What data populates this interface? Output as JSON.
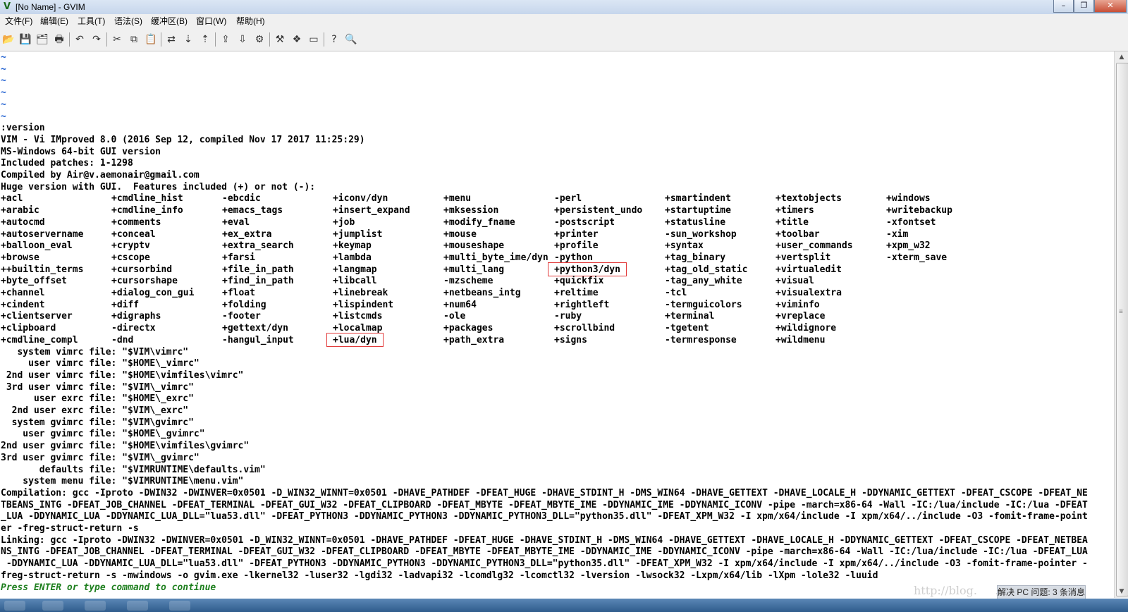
{
  "window": {
    "title": "[No Name] - GVIM"
  },
  "menubar": [
    "文件(F)",
    "编辑(E)",
    "工具(T)",
    "语法(S)",
    "缓冲区(B)",
    "窗口(W)",
    "帮助(H)"
  ],
  "toolbar": [
    {
      "name": "open-icon",
      "glyph": "📂"
    },
    {
      "name": "save-icon",
      "glyph": "💾"
    },
    {
      "name": "save-all-icon",
      "glyph": "🗂"
    },
    {
      "name": "print-icon",
      "glyph": "🖶"
    },
    {
      "sep": true
    },
    {
      "name": "undo-icon",
      "glyph": "↶"
    },
    {
      "name": "redo-icon",
      "glyph": "↷"
    },
    {
      "sep": true
    },
    {
      "name": "cut-icon",
      "glyph": "✂"
    },
    {
      "name": "copy-icon",
      "glyph": "⧉"
    },
    {
      "name": "paste-icon",
      "glyph": "📋"
    },
    {
      "sep": true
    },
    {
      "name": "replace-icon",
      "glyph": "⇄"
    },
    {
      "name": "find-next-icon",
      "glyph": "⇣"
    },
    {
      "name": "find-prev-icon",
      "glyph": "⇡"
    },
    {
      "sep": true
    },
    {
      "name": "load-session-icon",
      "glyph": "⇪"
    },
    {
      "name": "save-session-icon",
      "glyph": "⇩"
    },
    {
      "name": "run-script-icon",
      "glyph": "⚙"
    },
    {
      "sep": true
    },
    {
      "name": "make-icon",
      "glyph": "⚒"
    },
    {
      "name": "shell-icon",
      "glyph": "❖"
    },
    {
      "name": "tags-icon",
      "glyph": "▭"
    },
    {
      "sep": true
    },
    {
      "name": "help-icon",
      "glyph": "?"
    },
    {
      "name": "find-help-icon",
      "glyph": "🔍"
    }
  ],
  "editor": {
    "tilde_lines": [
      "~",
      "~",
      "~",
      "~",
      "~",
      "~"
    ],
    "header_lines": [
      ":version",
      "VIM - Vi IMproved 8.0 (2016 Sep 12, compiled Nov 17 2017 11:25:29)",
      "MS-Windows 64-bit GUI version",
      "Included patches: 1-1298",
      "Compiled by Air@v.aemonair@gmail.com",
      "Huge version with GUI.  Features included (+) or not (-):"
    ],
    "feature_columns": [
      [
        "+acl",
        "+arabic",
        "+autocmd",
        "+autoservername",
        "+balloon_eval",
        "+browse",
        "++builtin_terms",
        "+byte_offset",
        "+channel",
        "+cindent",
        "+clientserver",
        "+clipboard",
        "+cmdline_compl"
      ],
      [
        "+cmdline_hist",
        "+cmdline_info",
        "+comments",
        "+conceal",
        "+cryptv",
        "+cscope",
        "+cursorbind",
        "+cursorshape",
        "+dialog_con_gui",
        "+diff",
        "+digraphs",
        "-directx",
        "-dnd"
      ],
      [
        "-ebcdic",
        "+emacs_tags",
        "+eval",
        "+ex_extra",
        "+extra_search",
        "+farsi",
        "+file_in_path",
        "+find_in_path",
        "+float",
        "+folding",
        "-footer",
        "+gettext/dyn",
        "-hangul_input"
      ],
      [
        "+iconv/dyn",
        "+insert_expand",
        "+job",
        "+jumplist",
        "+keymap",
        "+lambda",
        "+langmap",
        "+libcall",
        "+linebreak",
        "+lispindent",
        "+listcmds",
        "+localmap",
        "+lua/dyn"
      ],
      [
        "+menu",
        "+mksession",
        "+modify_fname",
        "+mouse",
        "+mouseshape",
        "+multi_byte_ime/dyn",
        "+multi_lang",
        "-mzscheme",
        "+netbeans_intg",
        "+num64",
        "-ole",
        "+packages",
        "+path_extra"
      ],
      [
        "-perl",
        "+persistent_undo",
        "-postscript",
        "+printer",
        "+profile",
        "-python",
        "+python3/dyn",
        "+quickfix",
        "+reltime",
        "+rightleft",
        "-ruby",
        "+scrollbind",
        "+signs"
      ],
      [
        "+smartindent",
        "+startuptime",
        "+statusline",
        "-sun_workshop",
        "+syntax",
        "+tag_binary",
        "+tag_old_static",
        "-tag_any_white",
        "-tcl",
        "-termguicolors",
        "+terminal",
        "-tgetent",
        "-termresponse"
      ],
      [
        "+textobjects",
        "+timers",
        "+title",
        "+toolbar",
        "+user_commands",
        "+vertsplit",
        "+virtualedit",
        "+visual",
        "+visualextra",
        "+viminfo",
        "+vreplace",
        "+wildignore",
        "+wildmenu"
      ],
      [
        "+windows",
        "+writebackup",
        "-xfontset",
        "-xim",
        "+xpm_w32",
        "-xterm_save"
      ]
    ],
    "highlighted_features": [
      "+python3/dyn",
      "+lua/dyn"
    ],
    "footer_lines": [
      "   system vimrc file: \"$VIM\\vimrc\"",
      "     user vimrc file: \"$HOME\\_vimrc\"",
      " 2nd user vimrc file: \"$HOME\\vimfiles\\vimrc\"",
      " 3rd user vimrc file: \"$VIM\\_vimrc\"",
      "      user exrc file: \"$HOME\\_exrc\"",
      "  2nd user exrc file: \"$VIM\\_exrc\"",
      "  system gvimrc file: \"$VIM\\gvimrc\"",
      "    user gvimrc file: \"$HOME\\_gvimrc\"",
      "2nd user gvimrc file: \"$HOME\\vimfiles\\gvimrc\"",
      "3rd user gvimrc file: \"$VIM\\_gvimrc\"",
      "       defaults file: \"$VIMRUNTIME\\defaults.vim\"",
      "    system menu file: \"$VIMRUNTIME\\menu.vim\"",
      "Compilation: gcc -Iproto -DWIN32 -DWINVER=0x0501 -D_WIN32_WINNT=0x0501 -DHAVE_PATHDEF -DFEAT_HUGE -DHAVE_STDINT_H -DMS_WIN64 -DHAVE_GETTEXT -DHAVE_LOCALE_H -DDYNAMIC_GETTEXT -DFEAT_CSCOPE -DFEAT_NE",
      "TBEANS_INTG -DFEAT_JOB_CHANNEL -DFEAT_TERMINAL -DFEAT_GUI_W32 -DFEAT_CLIPBOARD -DFEAT_MBYTE -DFEAT_MBYTE_IME -DDYNAMIC_IME -DDYNAMIC_ICONV -pipe -march=x86-64 -Wall -IC:/lua/include -IC:/lua -DFEAT",
      "_LUA -DDYNAMIC_LUA -DDYNAMIC_LUA_DLL=\"lua53.dll\" -DFEAT_PYTHON3 -DDYNAMIC_PYTHON3 -DDYNAMIC_PYTHON3_DLL=\"python35.dll\" -DFEAT_XPM_W32 -I xpm/x64/include -I xpm/x64/../include -O3 -fomit-frame-point",
      "er -freg-struct-return -s",
      "Linking: gcc -Iproto -DWIN32 -DWINVER=0x0501 -D_WIN32_WINNT=0x0501 -DHAVE_PATHDEF -DFEAT_HUGE -DHAVE_STDINT_H -DMS_WIN64 -DHAVE_GETTEXT -DHAVE_LOCALE_H -DDYNAMIC_GETTEXT -DFEAT_CSCOPE -DFEAT_NETBEA",
      "NS_INTG -DFEAT_JOB_CHANNEL -DFEAT_TERMINAL -DFEAT_GUI_W32 -DFEAT_CLIPBOARD -DFEAT_MBYTE -DFEAT_MBYTE_IME -DDYNAMIC_IME -DDYNAMIC_ICONV -pipe -march=x86-64 -Wall -IC:/lua/include -IC:/lua -DFEAT_LUA",
      " -DDYNAMIC_LUA -DDYNAMIC_LUA_DLL=\"lua53.dll\" -DFEAT_PYTHON3 -DDYNAMIC_PYTHON3 -DDYNAMIC_PYTHON3_DLL=\"python35.dll\" -DFEAT_XPM_W32 -I xpm/x64/include -I xpm/x64/../include -O3 -fomit-frame-pointer -",
      "freg-struct-return -s -mwindows -o gvim.exe -lkernel32 -luser32 -lgdi32 -ladvapi32 -lcomdlg32 -lcomctl32 -lversion -lwsock32 -Lxpm/x64/lib -lXpm -lole32 -luuid"
    ],
    "prompt": "Press ENTER or type command to continue"
  },
  "overlay": {
    "watermark": "http://blog.     .net/aemonair",
    "notification": "解决 PC 问题: 3 条消息"
  },
  "colors": {
    "tilde": "#1f5fd0",
    "prompt": "#1e7f1e",
    "highlight_box": "#e23b3b"
  }
}
